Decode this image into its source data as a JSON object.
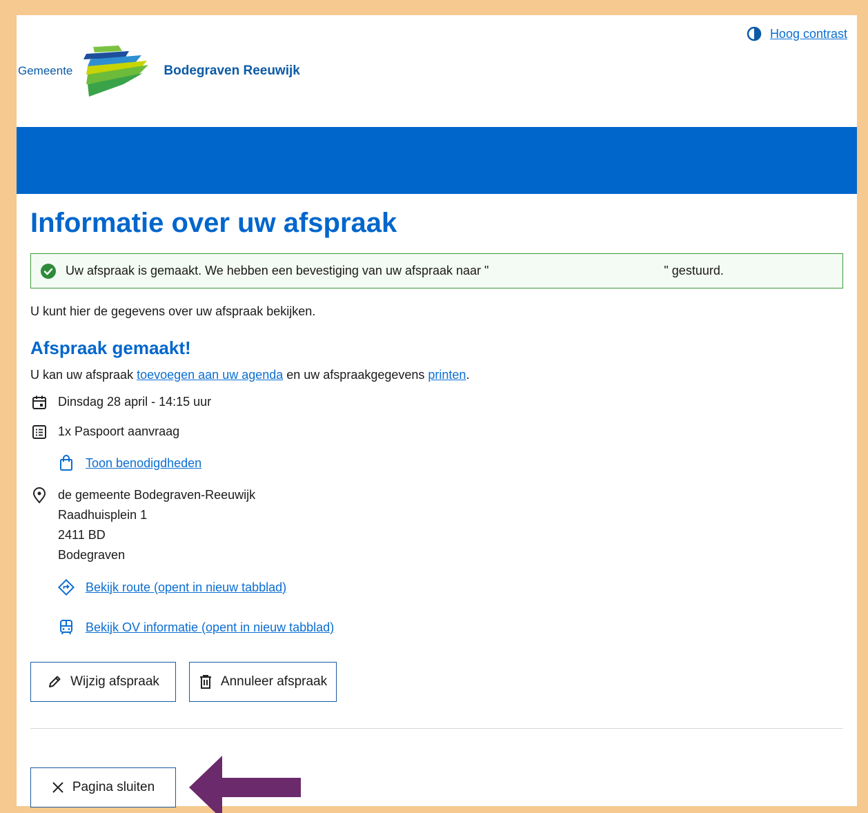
{
  "header": {
    "logo_prefix": "Gemeente",
    "logo_name": "Bodegraven Reeuwijk",
    "contrast_label": "Hoog contrast"
  },
  "main": {
    "title": "Informatie over uw afspraak",
    "alert": {
      "before": "Uw afspraak is gemaakt. We hebben een bevestiging van uw afspraak naar \"",
      "after": "\" gestuurd."
    },
    "intro": "U kunt hier de gegevens over uw afspraak bekijken.",
    "subtitle": "Afspraak gemaakt!",
    "help": {
      "part1": "U kan uw afspraak ",
      "link1": "toevoegen aan uw agenda",
      "part2": " en uw afspraakgegevens ",
      "link2": "printen",
      "part3": "."
    },
    "datetime": "Dinsdag 28 april - 14:15 uur",
    "product": "1x Paspoort aanvraag",
    "requirements_link": "Toon benodigdheden",
    "location": {
      "name": "de gemeente Bodegraven-Reeuwijk",
      "street": "Raadhuisplein 1",
      "postcode": "2411 BD",
      "city": "Bodegraven"
    },
    "route_link": "Bekijk route (opent in nieuw tabblad)",
    "ov_link": "Bekijk OV informatie (opent in nieuw tabblad)",
    "buttons": {
      "edit": "Wijzig afspraak",
      "cancel": "Annuleer afspraak",
      "close": "Pagina sluiten"
    }
  },
  "colors": {
    "brand_blue": "#0066cc",
    "link": "#0b6ed1",
    "success": "#2e8b3a",
    "frame": "#f5c98f",
    "arrow": "#6b2a6b"
  },
  "icons": [
    "contrast-icon",
    "check-circle-icon",
    "calendar-icon",
    "list-icon",
    "shopping-bag-icon",
    "location-pin-icon",
    "route-icon",
    "bus-icon",
    "pencil-icon",
    "trash-icon",
    "close-icon",
    "arrow-left-icon"
  ]
}
